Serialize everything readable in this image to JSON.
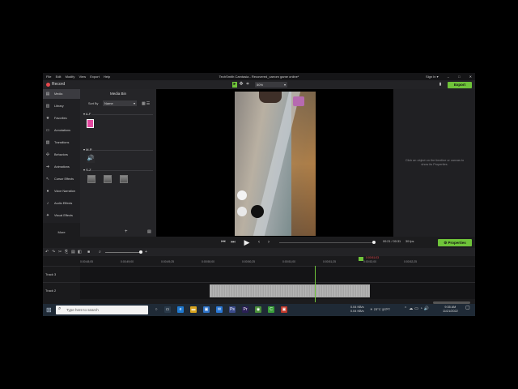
{
  "window": {
    "title": "TechSmith Camtasia - Recovered_carrom game online*",
    "menu": [
      "File",
      "Edit",
      "Modify",
      "View",
      "Export",
      "Help"
    ],
    "sign_in": "Sign In ▾",
    "controls": [
      "–",
      "□",
      "✕"
    ]
  },
  "toolbar": {
    "record_label": "Record",
    "zoom_value": "50%",
    "export_label": "Export"
  },
  "sidebar": {
    "items": [
      {
        "label": "Media",
        "icon": "media-icon"
      },
      {
        "label": "Library",
        "icon": "library-icon"
      },
      {
        "label": "Favorites",
        "icon": "star-icon"
      },
      {
        "label": "Annotations",
        "icon": "annotation-icon"
      },
      {
        "label": "Transitions",
        "icon": "transition-icon"
      },
      {
        "label": "Behaviors",
        "icon": "behavior-icon"
      },
      {
        "label": "Animations",
        "icon": "animation-icon"
      },
      {
        "label": "Cursor Effects",
        "icon": "cursor-icon"
      },
      {
        "label": "Voice Narration",
        "icon": "microphone-icon"
      },
      {
        "label": "Audio Effects",
        "icon": "audio-icon"
      },
      {
        "label": "Visual Effects",
        "icon": "visual-effects-icon"
      }
    ],
    "more_label": "More"
  },
  "media_bin": {
    "title": "Media Bin",
    "sort_by_label": "Sort By",
    "sort_value": "Name",
    "groups": [
      "A-F",
      "M-R",
      "S-Z"
    ]
  },
  "properties": {
    "hint": "Click an object on the timeline or canvas to show its Properties.",
    "button_label": "Properties"
  },
  "playback": {
    "timecode": "00:21 / 00:31",
    "fps": "30 fps"
  },
  "timeline": {
    "ticks": [
      "0:00:48;05",
      "0:00:49;00",
      "0:00:49;25",
      "0:00:50;00",
      "0:00:50;25",
      "0:00:51;00",
      "0:00:51;25",
      "0:00:52;00",
      "0:00:52;25"
    ],
    "playhead_time": "0:00:51;03",
    "tracks": [
      "Track 3",
      "Track 2"
    ]
  },
  "taskbar": {
    "search_placeholder": "Type here to search",
    "tray_text_1": "0.04 KB/s",
    "tray_text_2": "0.04 KB/s",
    "weather": "23°C কুয়াশা",
    "time": "9:35 AM",
    "date": "11/21/2022"
  }
}
